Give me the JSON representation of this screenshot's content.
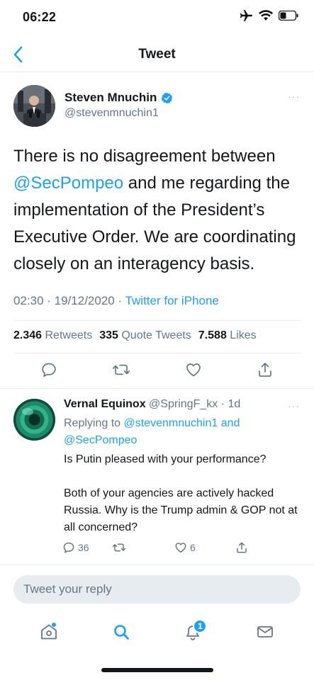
{
  "status_bar": {
    "time": "06:22"
  },
  "header": {
    "title": "Tweet"
  },
  "tweet": {
    "author_name": "Steven Mnuchin",
    "author_handle": "@stevenmnuchin1",
    "text_lines": [
      [
        "There is no disagreement between",
        ""
      ],
      [
        "",
        "@SecPompeo",
        " and me regarding the"
      ],
      [
        "implementation of the President’s"
      ],
      [
        "Executive Order. We are coordinating"
      ],
      [
        "closely on an interagency basis."
      ]
    ],
    "line1": "There is no disagreement between",
    "line2_mention": "@SecPompeo",
    "line2_rest": " and me regarding the",
    "line3": "implementation of the President’s",
    "line4": "Executive Order. We are coordinating",
    "line5": "closely on an interagency basis.",
    "time": "02:30",
    "date": "19/12/2020",
    "source": "Twitter for iPhone",
    "retweets_count": "2.346",
    "retweets_label": "Retweets",
    "quotes_count": "335",
    "quotes_label": "Quote Tweets",
    "likes_count": "7.588",
    "likes_label": "Likes",
    "more_label": "···"
  },
  "reply": {
    "author_name": "Vernal Equinox",
    "author_handle": "@SpringF_kx",
    "age": "1d",
    "replying_prefix": "Replying to ",
    "replying_to_1": "@stevenmnuchin1",
    "replying_and": " and",
    "replying_to_2": "@SecPompeo",
    "paragraph_1": "Is Putin pleased with your performance?",
    "paragraph_2": "Both of your agencies are actively hacked Russia. Why is the Trump admin & GOP not at all concerned?",
    "reply_count": "36",
    "like_count": "6",
    "more_label": "···"
  },
  "compose": {
    "placeholder": "Tweet your reply"
  },
  "tabbar": {
    "notifications_badge": "1"
  },
  "colors": {
    "accent": "#1da1f2",
    "text": "#14171a",
    "muted": "#657786",
    "divider": "#e6ecf0"
  }
}
